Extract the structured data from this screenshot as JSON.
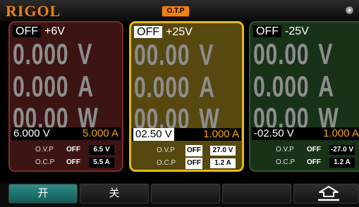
{
  "header": {
    "brand": "RIGOL",
    "otp_badge": "O.T.P"
  },
  "channels": [
    {
      "state": "OFF",
      "name": "+6V",
      "meas_voltage": "0.000",
      "voltage_unit": "V",
      "meas_current": "0.000",
      "current_unit": "A",
      "meas_power": "00.00",
      "power_unit": "W",
      "set_voltage": "6.000 V",
      "set_current": "5.000 A",
      "ovp_label": "O.V.P",
      "ovp_state": "OFF",
      "ovp_value": "6.5 V",
      "ocp_label": "O.C.P",
      "ocp_state": "OFF",
      "ocp_value": "5.5 A"
    },
    {
      "state": "OFF",
      "name": "+25V",
      "meas_voltage": "00.00",
      "voltage_unit": "V",
      "meas_current": "0.000",
      "current_unit": "A",
      "meas_power": "00.00",
      "power_unit": "W",
      "set_voltage": "02.50 V",
      "set_current": "1.000 A",
      "ovp_label": "O.V.P",
      "ovp_state": "OFF",
      "ovp_value": "27.0 V",
      "ocp_label": "O.C.P",
      "ocp_state": "OFF",
      "ocp_value": "1.2 A"
    },
    {
      "state": "OFF",
      "name": "-25V",
      "meas_voltage": "00.00",
      "voltage_unit": "V",
      "meas_current": "0.000",
      "current_unit": "A",
      "meas_power": "00.00",
      "power_unit": "W",
      "set_voltage": "-02.50 V",
      "set_current": "1.000 A",
      "ovp_label": "O.V.P",
      "ovp_state": "OFF",
      "ovp_value": "-27.0 V",
      "ocp_label": "O.C.P",
      "ocp_state": "OFF",
      "ocp_value": "1.2 A"
    }
  ],
  "softkeys": {
    "on_label": "开",
    "off_label": "关",
    "key3_label": "",
    "key4_label": "",
    "back_icon": "return-arrow-icon"
  },
  "colors": {
    "brand": "#f07f16",
    "set_current": "#f6a21b",
    "ch1_border": "#7a2e2e",
    "ch2_border": "#e3b91c",
    "ch3_border": "#2e5a2e",
    "active_softkey": "#2d8d87"
  }
}
